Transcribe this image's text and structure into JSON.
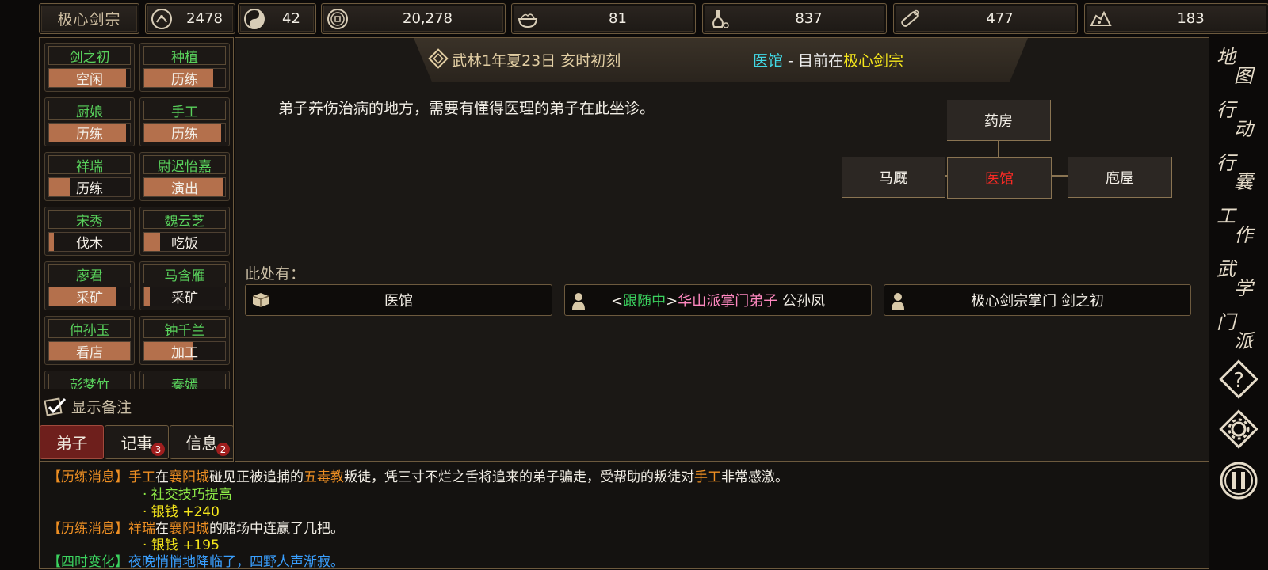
{
  "resources": {
    "sect_name": "极心剑宗",
    "items": [
      {
        "icon": "reputation-icon",
        "value": "2478"
      },
      {
        "icon": "yin-yang-icon",
        "value": "42"
      },
      {
        "icon": "coin-icon",
        "value": "20,278"
      },
      {
        "icon": "food-bowl-icon",
        "value": "81"
      },
      {
        "icon": "herb-icon",
        "value": "837"
      },
      {
        "icon": "wood-icon",
        "value": "477"
      },
      {
        "icon": "ore-icon",
        "value": "183"
      }
    ]
  },
  "disciples": [
    {
      "name": "剑之初",
      "task": "空闲",
      "progress": 0.95
    },
    {
      "name": "种植",
      "task": "历练",
      "progress": 0.85
    },
    {
      "name": "厨娘",
      "task": "历练",
      "progress": 0.95
    },
    {
      "name": "手工",
      "task": "历练",
      "progress": 0.95
    },
    {
      "name": "祥瑞",
      "task": "历练",
      "progress": 0.25
    },
    {
      "name": "尉迟怡嘉",
      "task": "演出",
      "progress": 0.98
    },
    {
      "name": "宋秀",
      "task": "伐木",
      "progress": 0.06
    },
    {
      "name": "魏云芝",
      "task": "吃饭",
      "progress": 0.2
    },
    {
      "name": "廖君",
      "task": "采矿",
      "progress": 0.83
    },
    {
      "name": "马含雁",
      "task": "采矿",
      "progress": 0.07
    },
    {
      "name": "仲孙玉",
      "task": "看店",
      "progress": 1.0
    },
    {
      "name": "钟千兰",
      "task": "加工",
      "progress": 0.6
    },
    {
      "name": "彭梦竹",
      "task": "",
      "progress": 0
    },
    {
      "name": "秦嫣",
      "task": "",
      "progress": 0
    }
  ],
  "memo_label": "显示备注",
  "tabs": [
    {
      "label": "弟子",
      "badge": ""
    },
    {
      "label": "记事",
      "badge": "3"
    },
    {
      "label": "信息",
      "badge": "2"
    }
  ],
  "header": {
    "date": "武林1年夏23日 亥时初刻",
    "place": "医馆",
    "sep": " - 目前在",
    "sect": "极心剑宗"
  },
  "description": "弟子养伤治病的地方，需要有懂得医理的弟子在此坐诊。",
  "map": {
    "top": "药房",
    "left": "马厩",
    "center": "医馆",
    "right": "庖屋"
  },
  "here_label": "此处有：",
  "entities": [
    {
      "icon": "box-icon",
      "text": "医馆"
    },
    {
      "icon": "person-icon",
      "prefix_open": "<",
      "status": "跟随中",
      "prefix_close": ">",
      "title": "华山派掌门弟子",
      "name": " 公孙凤"
    },
    {
      "icon": "person-icon",
      "text": "极心剑宗掌门 剑之初"
    }
  ],
  "sidebar": [
    {
      "c1": "地",
      "c2": "图"
    },
    {
      "c1": "行",
      "c2": "动"
    },
    {
      "c1": "行",
      "c2": "囊"
    },
    {
      "c1": "工",
      "c2": "作"
    },
    {
      "c1": "武",
      "c2": "学"
    },
    {
      "c1": "门",
      "c2": "派"
    }
  ],
  "log": {
    "l1": {
      "tag": "【历练消息】",
      "a": "手工",
      "b": "在",
      "c": "襄阳城",
      "d": "碰见正被追捕的",
      "e": "五毒教",
      "f": "叛徒，凭三寸不烂之舌将追来的弟子骗走，受帮助的叛徒对",
      "g": "手工",
      "h": "非常感激。"
    },
    "l2": "· 社交技巧提高",
    "l3": "· 银钱 +240",
    "l4": {
      "tag": "【历练消息】",
      "a": "祥瑞",
      "b": "在",
      "c": "襄阳城",
      "d": "的赌场中连赢了几把。"
    },
    "l5": "· 银钱 +195",
    "l6": {
      "tag": "【四时变化】",
      "text": "夜晚悄悄地降临了，四野人声渐寂。"
    }
  },
  "colors": {
    "accent_gold": "#6d5a3e",
    "progress_fill": "#b4704c",
    "active_tab": "#6e1f1c",
    "current_room": "#ff2a24"
  }
}
